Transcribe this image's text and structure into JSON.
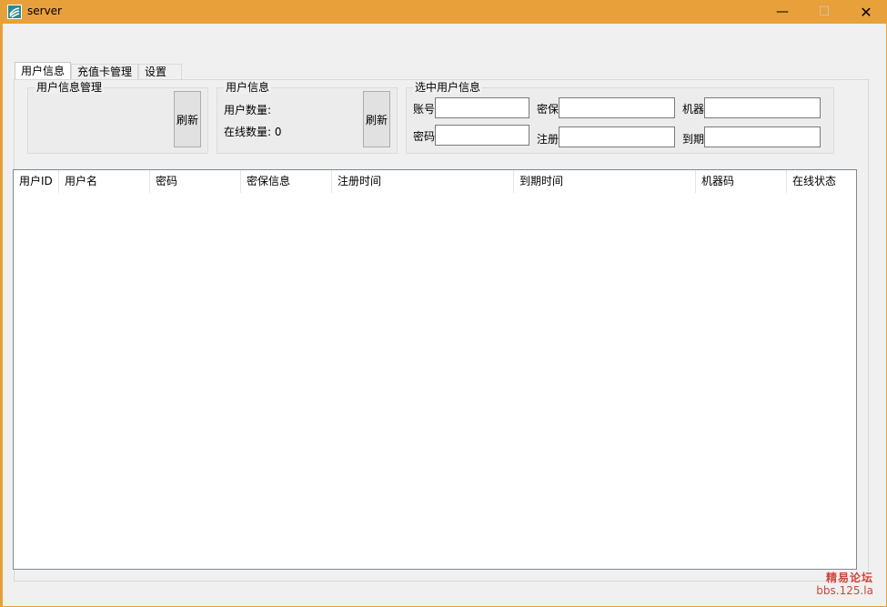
{
  "window": {
    "title": "server",
    "controls": {
      "minimize": "—",
      "maximize": "☐",
      "close": "✕"
    }
  },
  "tabs": [
    {
      "label": "用户信息",
      "active": true
    },
    {
      "label": "充值卡管理",
      "active": false
    },
    {
      "label": "设置",
      "active": false
    }
  ],
  "user_mgmt_group": {
    "title": "用户信息管理",
    "refresh_label": "刷新"
  },
  "user_info_group": {
    "title": "用户信息",
    "user_count_label": "用户数量:",
    "online_count_label": "在线数量:",
    "online_count_value": "0",
    "refresh_label": "刷新"
  },
  "selected_user_group": {
    "title": "选中用户信息",
    "fields": {
      "account": {
        "label": "账号",
        "value": ""
      },
      "security": {
        "label": "密保",
        "value": ""
      },
      "machine": {
        "label": "机器",
        "value": ""
      },
      "password": {
        "label": "密码",
        "value": ""
      },
      "register": {
        "label": "注册",
        "value": ""
      },
      "expire": {
        "label": "到期",
        "value": ""
      }
    }
  },
  "table": {
    "columns": [
      "用户ID",
      "用户名",
      "密码",
      "密保信息",
      "注册时间",
      "到期时间",
      "机器码",
      "在线状态"
    ],
    "rows": []
  },
  "watermark": {
    "line1": "精易论坛",
    "line2": "bbs.125.la"
  },
  "colors": {
    "titlebar": "#e8a03a",
    "watermark": "#d0463c"
  }
}
